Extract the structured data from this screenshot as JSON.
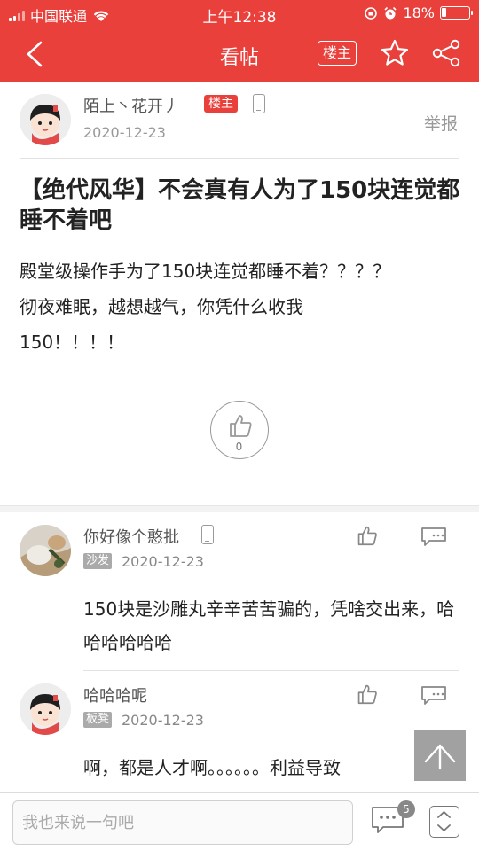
{
  "status_bar": {
    "carrier": "中国联通",
    "time": "上午12:38",
    "battery_percent": "18%",
    "battery_level": 0.18
  },
  "nav": {
    "title": "看帖",
    "owner_label": "楼主"
  },
  "author": {
    "name": "陌上丶花开丿",
    "badge": "楼主",
    "date": "2020-12-23",
    "report_label": "举报"
  },
  "post": {
    "title": "【绝代风华】不会真有人为了150块连觉都睡不着吧",
    "body_line1": "殿堂级操作手为了150块连觉都睡不着？？？？",
    "body_line2": "彻夜难眠，越想越气，你凭什么收我",
    "body_line3": "150！！！！",
    "like_count": "0"
  },
  "comments": [
    {
      "name": "你好像个憨批",
      "tag": "沙发",
      "date": "2020-12-23",
      "text": "150块是沙雕丸辛辛苦苦骗的，凭啥交出来，哈哈哈哈哈哈"
    },
    {
      "name": "哈哈哈呢",
      "tag": "板凳",
      "date": "2020-12-23",
      "text": "啊，都是人才啊。。。。。。利益导致"
    }
  ],
  "bottom": {
    "input_placeholder": "我也来说一句吧",
    "comment_count": "5"
  },
  "colors": {
    "brand_red": "#e9403c",
    "badge_gray": "#aaaaaa"
  },
  "icons": [
    "back-arrow-icon",
    "star-icon",
    "share-icon",
    "phone-icon",
    "thumbs-up-icon",
    "reply-bubble-icon",
    "chat-bubble-icon",
    "up-arrow-icon",
    "scroll-toggle-icon"
  ]
}
